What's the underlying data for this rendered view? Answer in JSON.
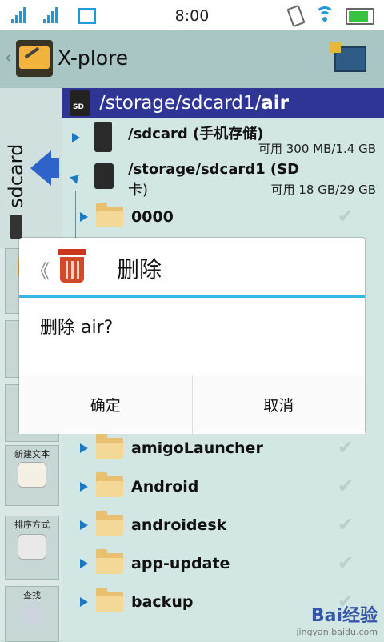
{
  "status": {
    "time": "8:00"
  },
  "app": {
    "title": "X-plore"
  },
  "sidebar": {
    "drive_label": "sdcard",
    "tools": [
      {
        "label": "新建文本"
      },
      {
        "label": "排序方式"
      },
      {
        "label": "查找"
      }
    ]
  },
  "path": {
    "prefix": "/storage/sdcard1/",
    "current": "air"
  },
  "drives": [
    {
      "name": "/sdcard (手机存储)",
      "info": "可用 300 MB/1.4 GB"
    },
    {
      "name": "/storage/sdcard1 (SD",
      "name2": "卡)",
      "info": "可用 18 GB/29 GB"
    }
  ],
  "folders_top": [
    "0000"
  ],
  "folders": [
    "amigoLauncher",
    "Android",
    "androidesk",
    "app-update",
    "backup"
  ],
  "dialog": {
    "title": "删除",
    "message": "删除 air?",
    "confirm": "确定",
    "cancel": "取消"
  },
  "watermark": {
    "brand": "Bai经验",
    "url": "jingyan.baidu.com"
  }
}
